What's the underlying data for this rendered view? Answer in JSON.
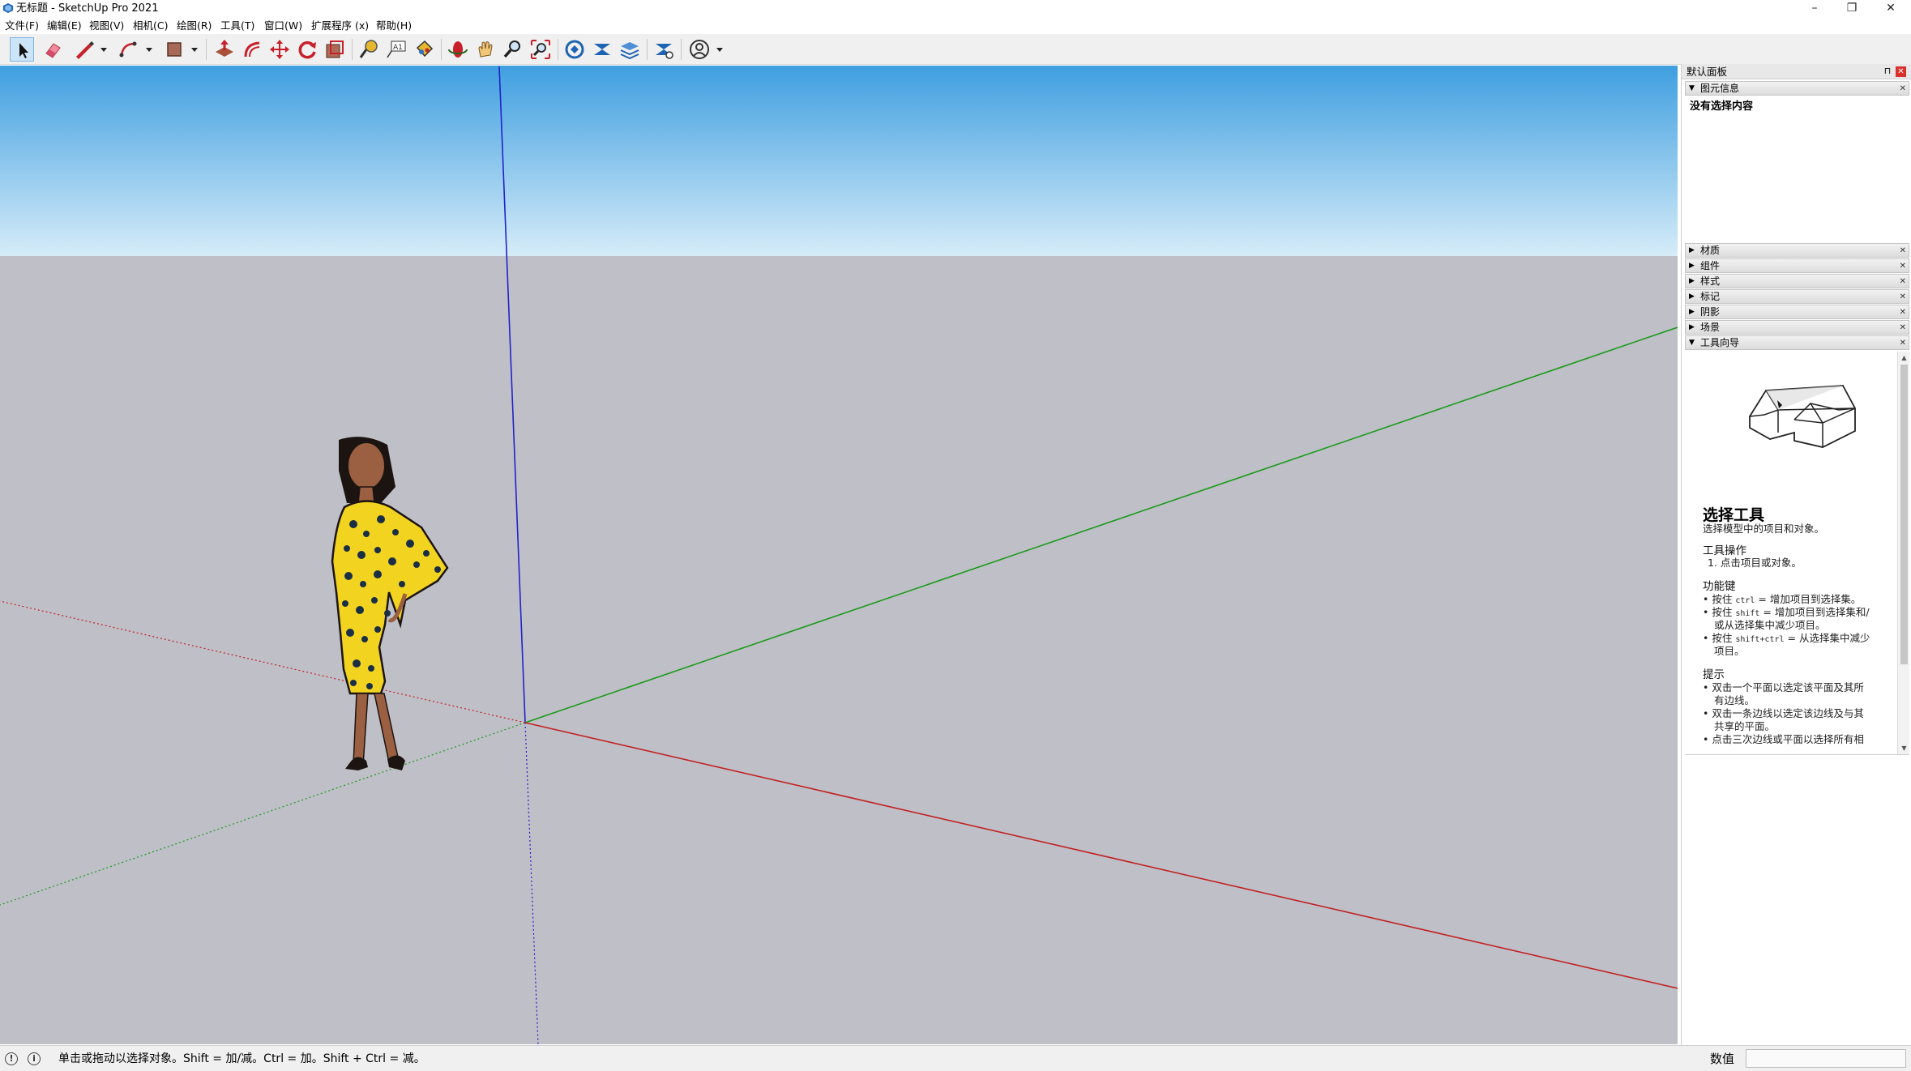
{
  "window": {
    "title": "无标题 - SketchUp Pro 2021",
    "controls": {
      "minimize": "–",
      "maximize": "❐",
      "close": "✕"
    }
  },
  "menu": {
    "items": [
      "文件(F)",
      "编辑(E)",
      "视图(V)",
      "相机(C)",
      "绘图(R)",
      "工具(T)",
      "窗口(W)",
      "扩展程序 (x)",
      "帮助(H)"
    ]
  },
  "toolbar": {
    "tools": [
      "select-icon",
      "eraser-icon",
      "line-icon",
      "arc-icon",
      "rectangle-icon",
      "push-pull-icon",
      "offset-icon",
      "move-icon",
      "rotate-icon",
      "scale-icon",
      "tape-measure-icon",
      "text-icon",
      "paint-bucket-icon",
      "orbit-icon",
      "pan-icon",
      "zoom-icon",
      "zoom-extents-icon",
      "warehouse-icon",
      "extension-warehouse-icon",
      "layout-icon",
      "extension-manager-icon",
      "account-icon"
    ]
  },
  "tray": {
    "title": "默认面板",
    "pin": "⊓",
    "close": "✕",
    "entity_info": {
      "label": "图元信息",
      "empty": "没有选择内容"
    },
    "panels": [
      "材质",
      "组件",
      "样式",
      "标记",
      "阴影",
      "场景"
    ],
    "instructor": {
      "label": "工具向导",
      "title": "选择工具",
      "subtitle": "选择模型中的项目和对象。",
      "ops_head": "工具操作",
      "ops": [
        "1. 点击项目或对象。"
      ],
      "keys_head": "功能键",
      "keys": [
        {
          "pre": "按住 ",
          "key": "ctrl",
          "post": " = 增加项目到选择集。"
        },
        {
          "pre": "按住 ",
          "key": "shift",
          "post": " = 增加项目到选择集和/"
        },
        {
          "pre": "",
          "key": "",
          "post": "或从选择集中减少项目。"
        },
        {
          "pre": "按住 ",
          "key": "shift+ctrl",
          "post": " = 从选择集中减少"
        },
        {
          "pre": "",
          "key": "",
          "post": "项目。"
        }
      ],
      "tips_head": "提示",
      "tips": [
        "双击一个平面以选定该平面及其所",
        "有边线。",
        "双击一条边线以选定该边线及与其",
        "共享的平面。",
        "点击三次边线或平面以选择所有相"
      ]
    }
  },
  "status": {
    "text": "单击或拖动以选择对象。Shift = 加/减。Ctrl = 加。Shift + Ctrl = 减。",
    "value_label": "数值",
    "value": ""
  },
  "colors": {
    "sky_top": "#3f9fe0",
    "sky_bottom": "#d6ecf8",
    "ground": "#bfbfc7",
    "axis_red": "#c22222",
    "axis_green": "#1a9a1a",
    "axis_blue": "#2222c8"
  }
}
